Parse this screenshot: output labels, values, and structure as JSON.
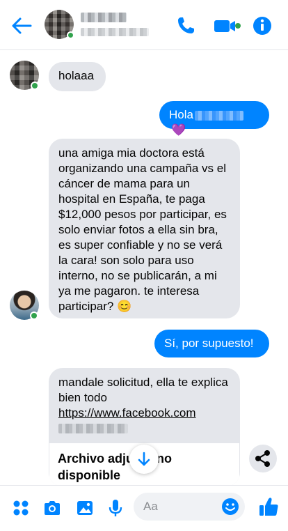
{
  "colors": {
    "accent": "#0084ff",
    "incoming_bubble": "#e4e6eb",
    "online": "#31a24c"
  },
  "header": {
    "icons": [
      "back-arrow-icon",
      "phone-icon",
      "video-camera-icon",
      "info-icon"
    ]
  },
  "messages": [
    {
      "side": "in",
      "text": "holaaa"
    },
    {
      "side": "out",
      "text": "Hola"
    },
    {
      "side": "in",
      "text": "una amiga mia doctora está organizando una campaña vs el cáncer de mama para un hospital en España, te paga $12,000 pesos por participar, es solo enviar fotos a ella sin bra, es super confiable y no se verá la cara! son solo para uso interno, no se publicarán, a mi ya me pagaron. te interesa participar? 😊"
    },
    {
      "side": "out",
      "text": "Sí, por supuesto!"
    },
    {
      "side": "in",
      "text": "mandale solicitud, ella te explica bien todo",
      "link": "https://www.facebook.com",
      "attachment": "Archivo adjunto no disponible"
    }
  ],
  "composer": {
    "placeholder": "Aa"
  },
  "footer": {
    "icons": [
      "apps-icon",
      "camera-icon",
      "gallery-icon",
      "microphone-icon",
      "emoji-icon",
      "thumbs-up-icon"
    ]
  }
}
